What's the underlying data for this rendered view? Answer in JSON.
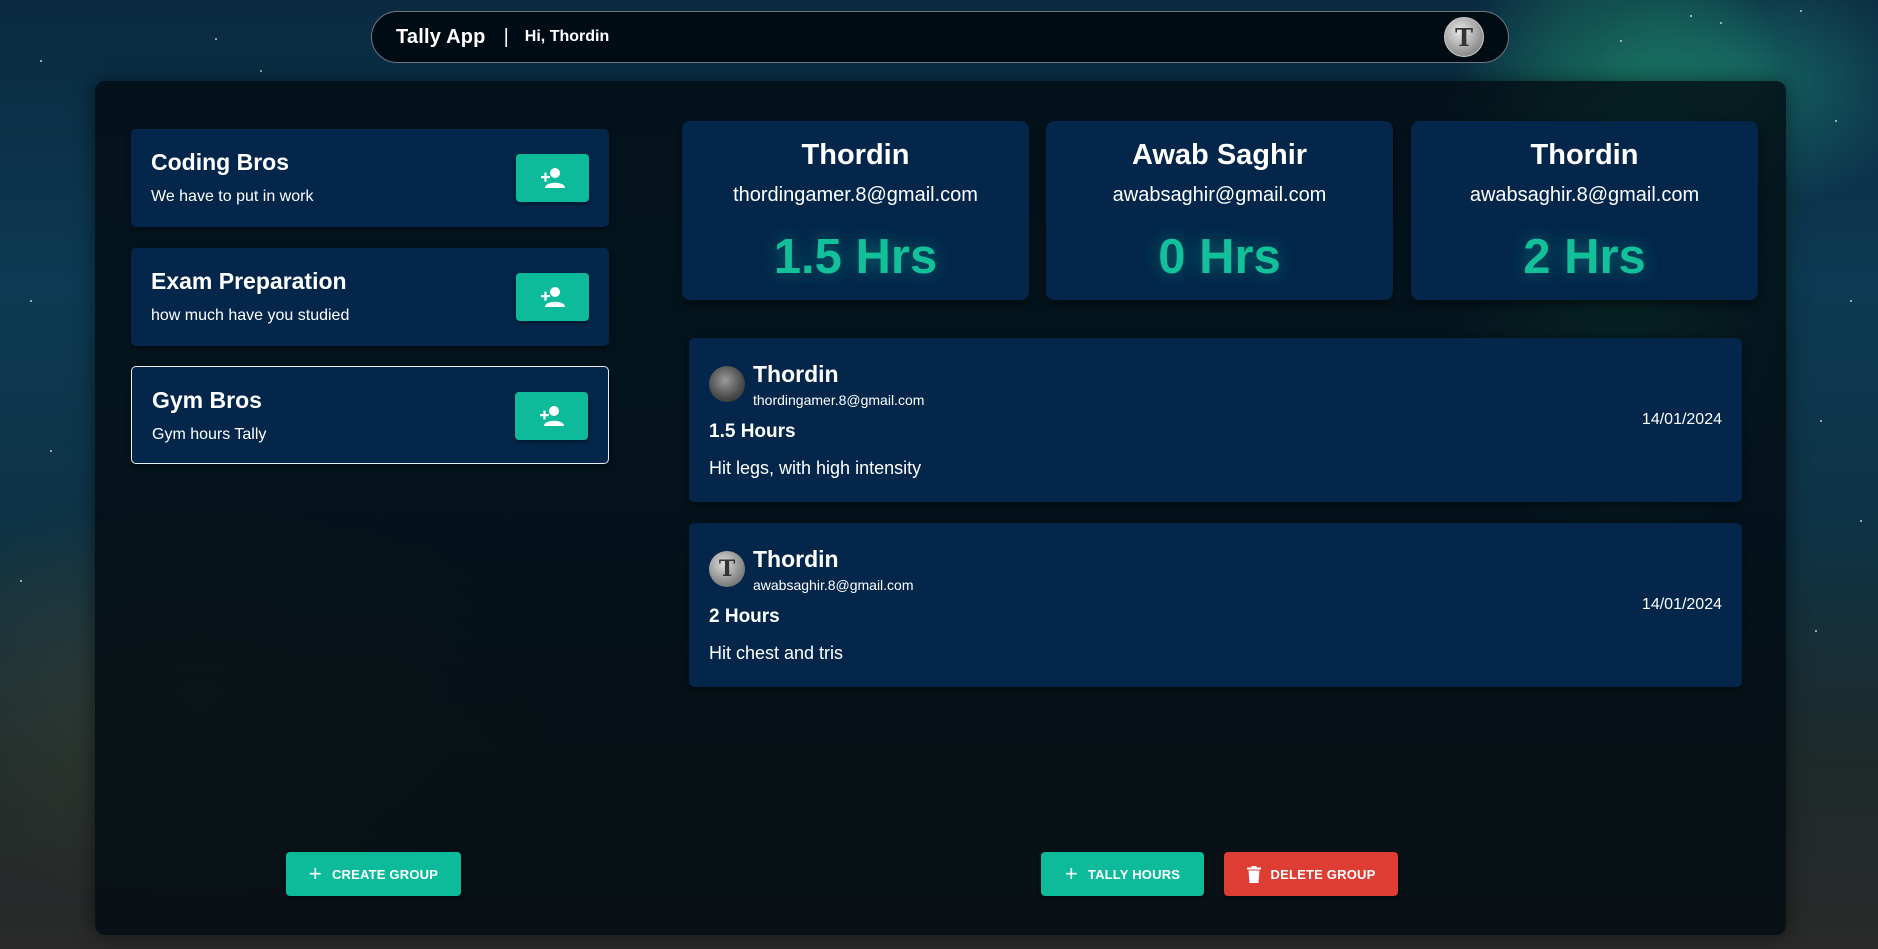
{
  "header": {
    "app_title": "Tally App",
    "separator": "|",
    "greeting": "Hi, Thordin",
    "avatar_letter": "T"
  },
  "groups": [
    {
      "name": "Coding Bros",
      "description": "We have to put in work",
      "selected": false
    },
    {
      "name": "Exam Preparation",
      "description": "how much have you studied",
      "selected": false
    },
    {
      "name": "Gym Bros",
      "description": "Gym hours Tally",
      "selected": true
    }
  ],
  "members": [
    {
      "name": "Thordin",
      "email": "thordingamer.8@gmail.com",
      "hours": "1.5 Hrs"
    },
    {
      "name": "Awab Saghir",
      "email": "awabsaghir@gmail.com",
      "hours": "0 Hrs"
    },
    {
      "name": "Thordin",
      "email": "awabsaghir.8@gmail.com",
      "hours": "2 Hrs"
    }
  ],
  "entries": [
    {
      "name": "Thordin",
      "email": "thordingamer.8@gmail.com",
      "hours": "1.5 Hours",
      "note": "Hit legs, with high intensity",
      "date": "14/01/2024",
      "avatar_letter": ""
    },
    {
      "name": "Thordin",
      "email": "awabsaghir.8@gmail.com",
      "hours": "2 Hours",
      "note": "Hit chest and tris",
      "date": "14/01/2024",
      "avatar_letter": "T"
    }
  ],
  "actions": {
    "create_group": "CREATE GROUP",
    "tally_hours": "TALLY HOURS",
    "delete_group": "DELETE GROUP",
    "plus_glyph": "+"
  },
  "colors": {
    "accent": "#0dbb9a",
    "danger": "#de3d34",
    "card": "#03264a"
  },
  "icons": {
    "add_member": "person-add-icon",
    "delete": "trash-icon",
    "add": "plus-icon"
  }
}
